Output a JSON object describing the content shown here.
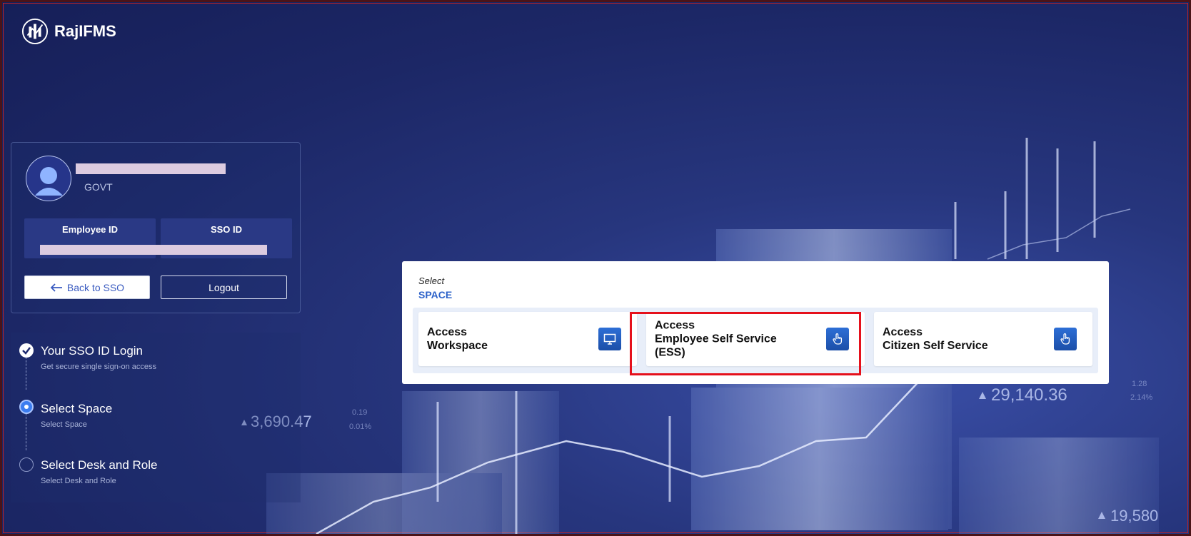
{
  "brand": {
    "name": "RajIFMS"
  },
  "profile": {
    "user_type": "GOVT",
    "employee_id_label": "Employee ID",
    "sso_id_label": "SSO ID",
    "back_label": "Back to SSO",
    "logout_label": "Logout"
  },
  "steps": [
    {
      "title": "Your SSO ID Login",
      "subtitle": "Get secure single sign-on access",
      "status": "done"
    },
    {
      "title": "Select Space",
      "subtitle": "Select Space",
      "status": "active"
    },
    {
      "title": "Select Desk and Role",
      "subtitle": "Select Desk and Role",
      "status": "pending"
    }
  ],
  "modal": {
    "select_label": "Select",
    "title": "SPACE",
    "cards": [
      {
        "line1": "Access",
        "line2": "Workspace",
        "line3": "",
        "icon": "monitor-icon"
      },
      {
        "line1": "Access",
        "line2": "Employee Self Service",
        "line3": "(ESS)",
        "icon": "hand-pointer-icon"
      },
      {
        "line1": "Access",
        "line2": "Citizen Self Service",
        "line3": "",
        "icon": "hand-pointer-icon"
      }
    ]
  },
  "background_figures": {
    "ticker_1": "3,690.47",
    "ticker_2": "29,140.36",
    "ticker_3": "19,580",
    "ticker_small_1": "0.19",
    "ticker_small_2": "0.01%",
    "ticker_small_3": "2.14%",
    "ticker_small_4": "1.28"
  },
  "colors": {
    "accent": "#2e63c9",
    "highlight": "#e5101b",
    "background": "#1c2766"
  }
}
